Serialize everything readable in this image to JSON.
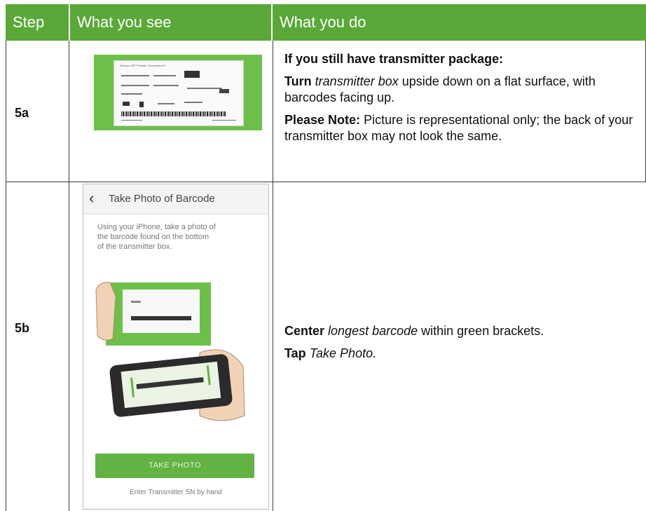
{
  "header": {
    "step": "Step",
    "see": "What you see",
    "do": "What you do"
  },
  "colors": {
    "header_bg": "#5aa838",
    "button_green": "#62b341"
  },
  "rows": [
    {
      "step": "5a",
      "image": {
        "type": "transmitter-box-barcode-label",
        "label_title": "Dexcom G5™ Mobile Transmitter Kit"
      },
      "do": {
        "heading": "If you still have transmitter package:",
        "p1_bold": "Turn",
        "p1_italic": "transmitter box",
        "p1_rest": "upside down on a flat surface, with barcodes facing up.",
        "p2_bold": "Please Note:",
        "p2_rest": "Picture is representational only; the back of your transmitter box may not look the same."
      }
    },
    {
      "step": "5b",
      "image": {
        "type": "phone-screen",
        "title": "Take Photo of Barcode",
        "instructions": "Using your iPhone, take a photo of the barcode found on the bottom of the transmitter box.",
        "button": "TAKE PHOTO",
        "link": "Enter Transmitter SN by hand"
      },
      "do": {
        "p1_bold": "Center",
        "p1_italic": "longest barcode",
        "p1_rest": "within green brackets.",
        "p2_bold": "Tap",
        "p2_italic": "Take Photo."
      }
    }
  ]
}
